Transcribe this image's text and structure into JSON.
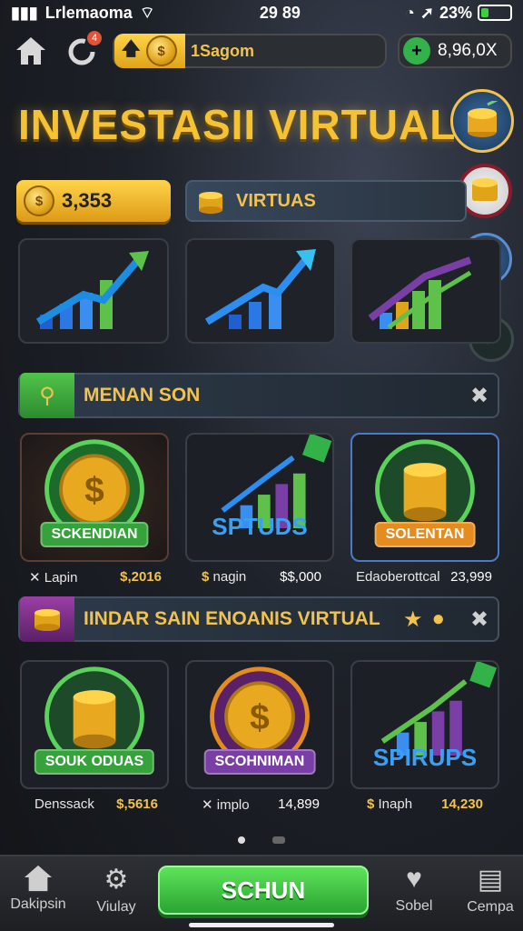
{
  "status_bar": {
    "carrier": "Lrlemaoma",
    "time": "29 89",
    "battery": "23%",
    "battery_level": 0.23
  },
  "top_bar": {
    "notification_count": "4",
    "coin_value": "1Sagom",
    "balance": "8,96,0X"
  },
  "title": "INVESTASII VIRTUAL",
  "balance_button": {
    "value": "3,353"
  },
  "virtual_pill": {
    "label": "VIRTUAS"
  },
  "section1": {
    "label": "MENAN SON",
    "cards": [
      {
        "label": "SCKENDIAN",
        "meta_left": "Lapin",
        "meta_right": "$,2016",
        "meta_left_icon": "x-icon",
        "meta_right_icon": "dollar"
      },
      {
        "label": "SPTUDS",
        "meta_left": "nagin",
        "meta_right": "$$,000",
        "meta_left_icon": "dollar"
      },
      {
        "label": "SOLENTAN",
        "meta_left": "Edaoberottcal",
        "meta_right": "23,999"
      }
    ]
  },
  "section2": {
    "label": "IINDAR SAIN ENOANIS VIRTUAL",
    "cards": [
      {
        "label": "SOUK ODUAS",
        "meta_left": "Denssack",
        "meta_right": "$,5616"
      },
      {
        "label": "SCOHNIMAN",
        "meta_left": "implo",
        "meta_right": "14,899",
        "meta_left_icon": "x-icon"
      },
      {
        "label": "SPIRUPS",
        "meta_left": "Inaph",
        "meta_right": "14,230",
        "meta_left_icon": "dollar"
      }
    ]
  },
  "bottom_nav": {
    "items": [
      "Dakipsin",
      "Viulay",
      "Sobel",
      "Cempa"
    ],
    "cta": "SCHUN"
  },
  "colors": {
    "gold": "#f2c24e",
    "green": "#34b24a",
    "orange": "#e58c1f",
    "purple": "#7a3fa6"
  }
}
